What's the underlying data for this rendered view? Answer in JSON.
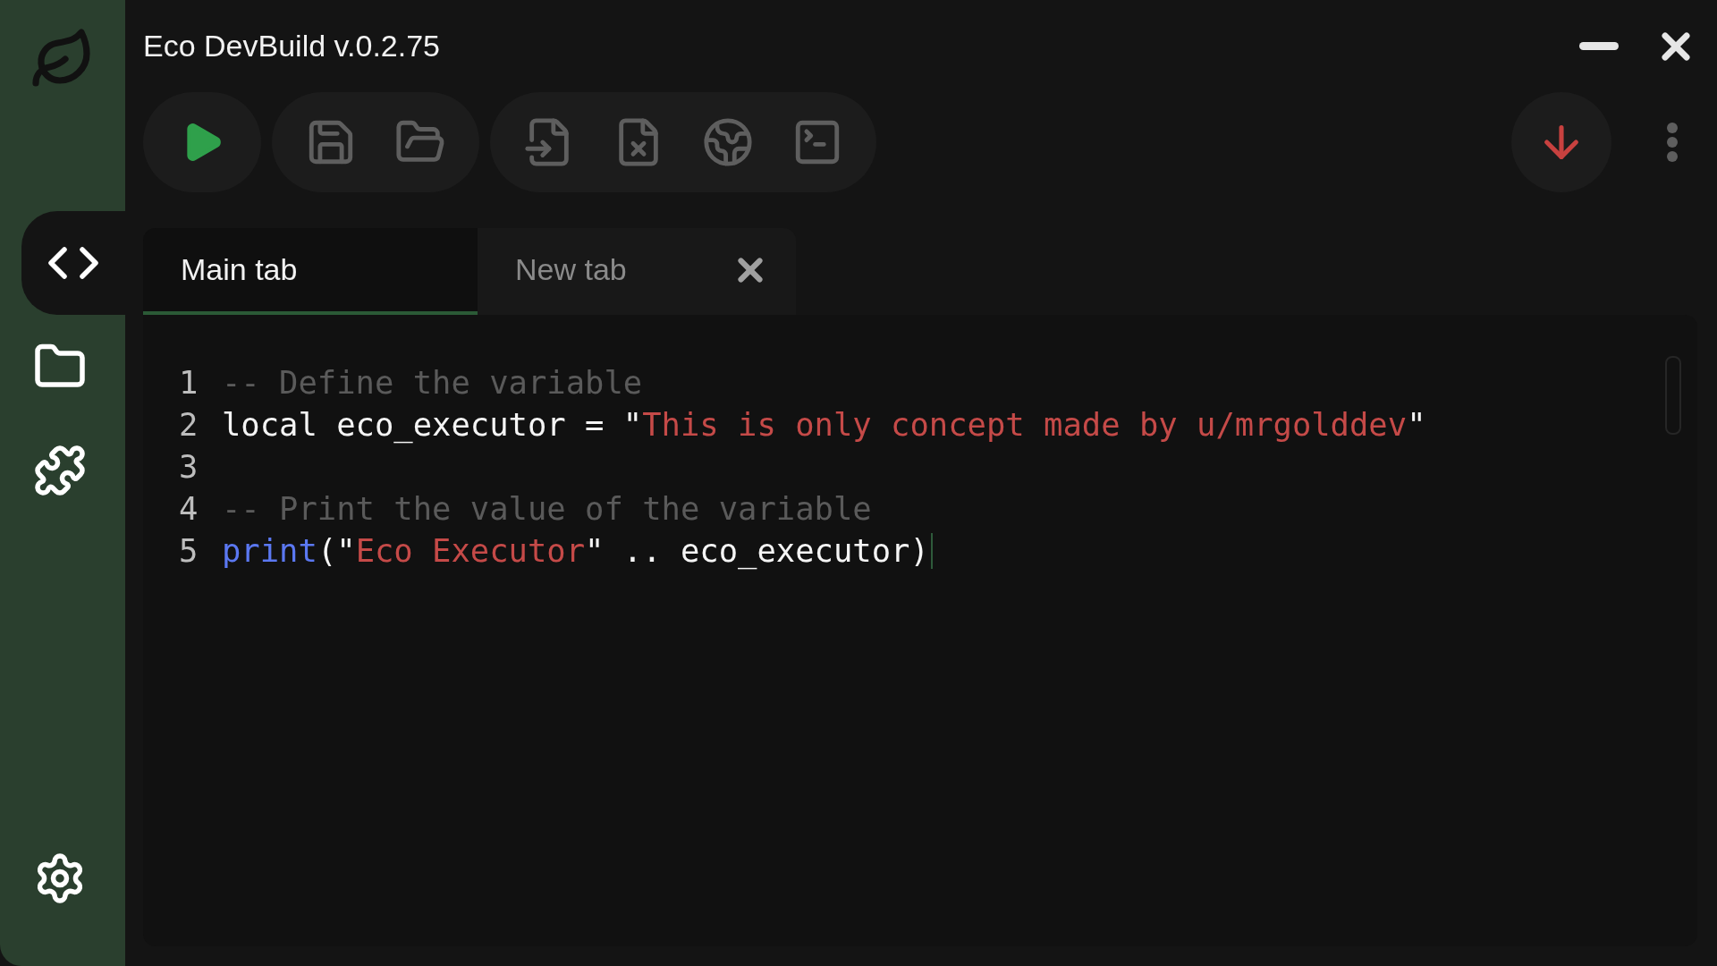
{
  "window": {
    "title": "Eco DevBuild v.0.2.75"
  },
  "sidebar": {
    "items": [
      {
        "kind": "code",
        "selected": true
      },
      {
        "kind": "folder",
        "selected": false
      },
      {
        "kind": "extensions",
        "selected": false
      }
    ],
    "bottom": [
      {
        "kind": "settings",
        "selected": false
      }
    ]
  },
  "toolbar": {
    "groups": [
      {
        "buttons": [
          {
            "kind": "run"
          }
        ]
      },
      {
        "buttons": [
          {
            "kind": "save"
          },
          {
            "kind": "open"
          }
        ]
      },
      {
        "buttons": [
          {
            "kind": "file-import"
          },
          {
            "kind": "file-close"
          },
          {
            "kind": "globe"
          },
          {
            "kind": "terminal"
          }
        ]
      }
    ],
    "right": [
      {
        "kind": "download"
      }
    ]
  },
  "tabs": [
    {
      "label": "Main tab",
      "selected": true,
      "closable": false
    },
    {
      "label": "New tab",
      "selected": false,
      "closable": true
    }
  ],
  "editor": {
    "lines": [
      {
        "number": "1",
        "cursor": false,
        "tokens": [
          {
            "kind": "comment",
            "text": "-- Define the variable"
          }
        ]
      },
      {
        "number": "2",
        "cursor": false,
        "tokens": [
          {
            "kind": "plain",
            "text": "local eco_executor = \""
          },
          {
            "kind": "string",
            "text": "This is only concept made by u/mrgolddev"
          },
          {
            "kind": "plain",
            "text": "\""
          }
        ]
      },
      {
        "number": "3",
        "cursor": false
      },
      {
        "number": "4",
        "cursor": false,
        "tokens": [
          {
            "kind": "comment",
            "text": "-- Print the value of the variable"
          }
        ]
      },
      {
        "number": "5",
        "cursor": true,
        "tokens": [
          {
            "kind": "function",
            "text": "print"
          },
          {
            "kind": "plain",
            "text": "(\""
          },
          {
            "kind": "string",
            "text": "Eco Executor"
          },
          {
            "kind": "plain",
            "text": "\" .. eco_executor)"
          }
        ]
      }
    ]
  }
}
